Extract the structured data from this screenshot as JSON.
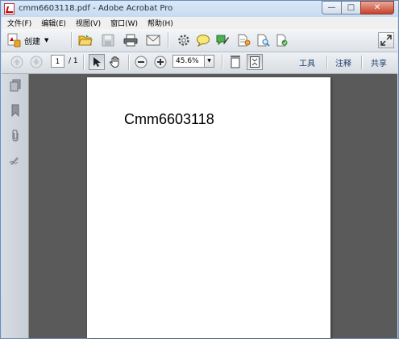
{
  "window": {
    "title": "cmm6603118.pdf - Adobe Acrobat Pro",
    "min_glyph": "—",
    "max_glyph": "□",
    "close_glyph": "✕"
  },
  "menu": [
    "文件(F)",
    "编辑(E)",
    "视图(V)",
    "窗口(W)",
    "帮助(H)"
  ],
  "toolbar": {
    "create_label": "创建",
    "create_caret": "▼"
  },
  "navigation": {
    "page_current": "1",
    "page_total": "/ 1",
    "zoom": "45.6%",
    "zoom_caret": "▼"
  },
  "right_links": {
    "tools": "工具",
    "comment": "注释",
    "share": "共享"
  },
  "document": {
    "page_text": "Cmm6603118"
  },
  "colors": {
    "doc_background": "#5a5a5a",
    "page": "#ffffff",
    "link_text": "#1b3d6e"
  }
}
